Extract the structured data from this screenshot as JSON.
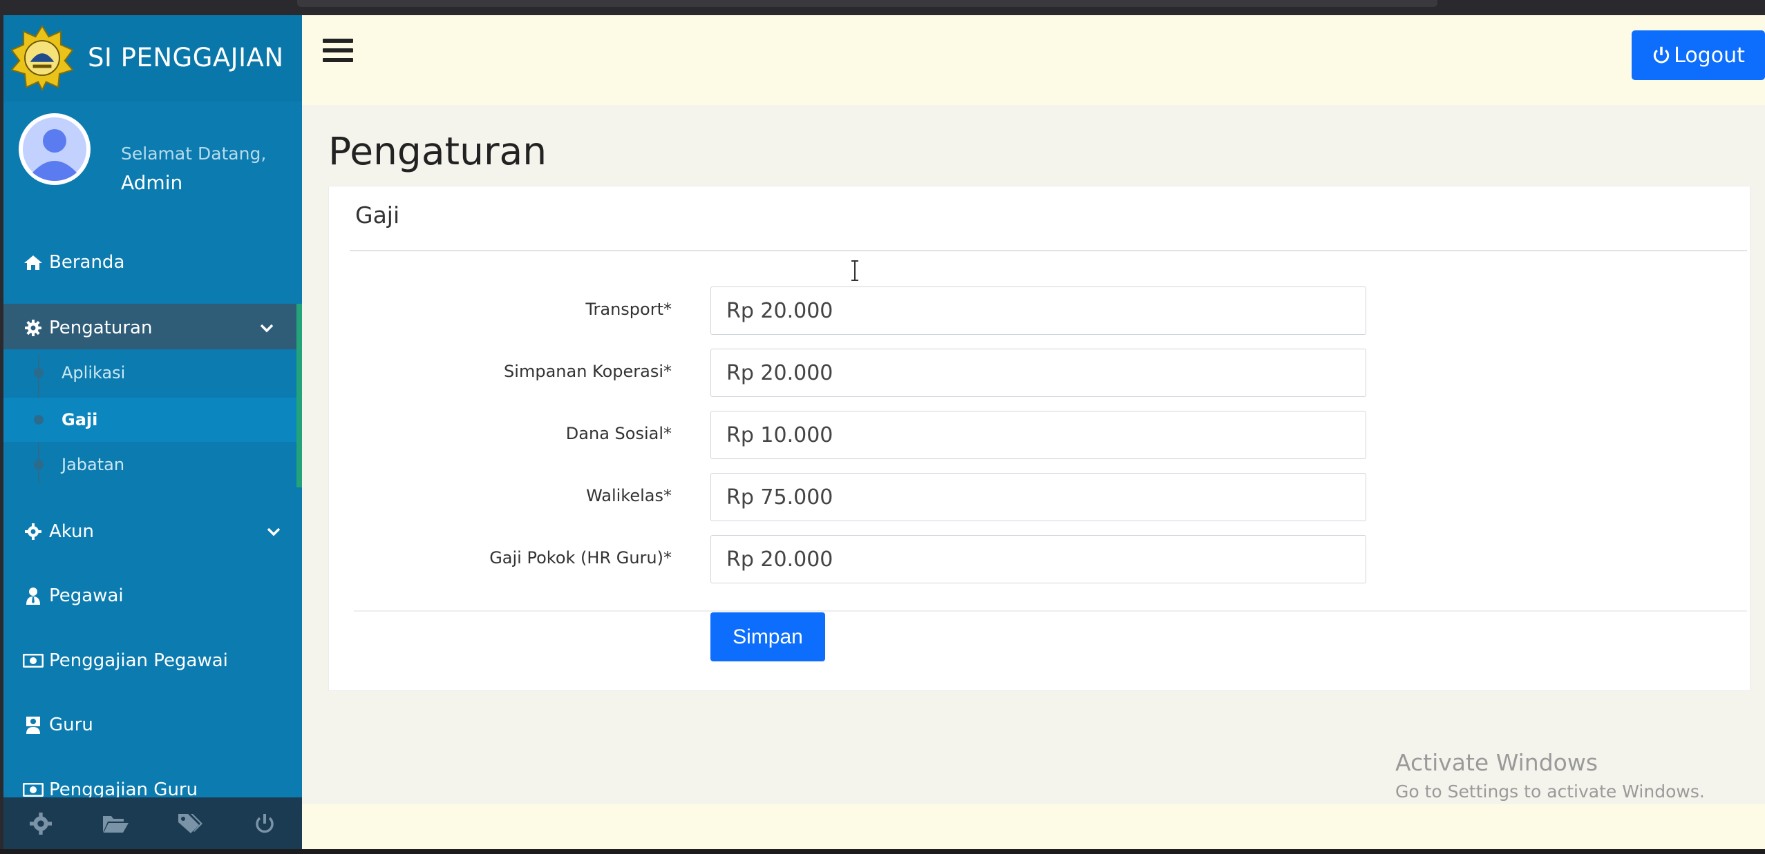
{
  "brand": {
    "title": "SI PENGGAJIAN"
  },
  "user": {
    "greeting": "Selamat Datang,",
    "name": "Admin"
  },
  "sidebar": {
    "items": [
      {
        "label": "Beranda",
        "icon": "home-icon"
      },
      {
        "label": "Pengaturan",
        "icon": "gear-icon",
        "expanded": true
      },
      {
        "label": "Akun",
        "icon": "gear-icon"
      },
      {
        "label": "Pegawai",
        "icon": "user-tie-icon"
      },
      {
        "label": "Penggajian Pegawai",
        "icon": "money-bill-icon"
      },
      {
        "label": "Guru",
        "icon": "teacher-icon"
      },
      {
        "label": "Penggajian Guru",
        "icon": "money-bill-icon"
      }
    ],
    "subitems": [
      {
        "label": "Aplikasi"
      },
      {
        "label": "Gaji",
        "current": true
      },
      {
        "label": "Jabatan"
      }
    ],
    "footer_icons": [
      "gear-icon",
      "folder-open-icon",
      "tags-icon",
      "power-icon"
    ]
  },
  "topbar": {
    "logout_label": "Logout"
  },
  "page": {
    "title": "Pengaturan"
  },
  "card": {
    "header": "Gaji",
    "fields": [
      {
        "label": "Transport*",
        "value": "Rp 20.000"
      },
      {
        "label": "Simpanan Koperasi*",
        "value": "Rp 20.000"
      },
      {
        "label": "Dana Sosial*",
        "value": "Rp 10.000"
      },
      {
        "label": "Walikelas*",
        "value": "Rp 75.000"
      },
      {
        "label": "Gaji Pokok (HR Guru)*",
        "value": "Rp 20.000"
      }
    ],
    "save_label": "Simpan"
  },
  "watermark": {
    "line1": "Activate Windows",
    "line2": "Go to Settings to activate Windows."
  },
  "colors": {
    "sidebar": "#0b7bb0",
    "active_item": "#2f5d78",
    "accent": "#0d6efd",
    "topbar": "#fdfbe6"
  }
}
